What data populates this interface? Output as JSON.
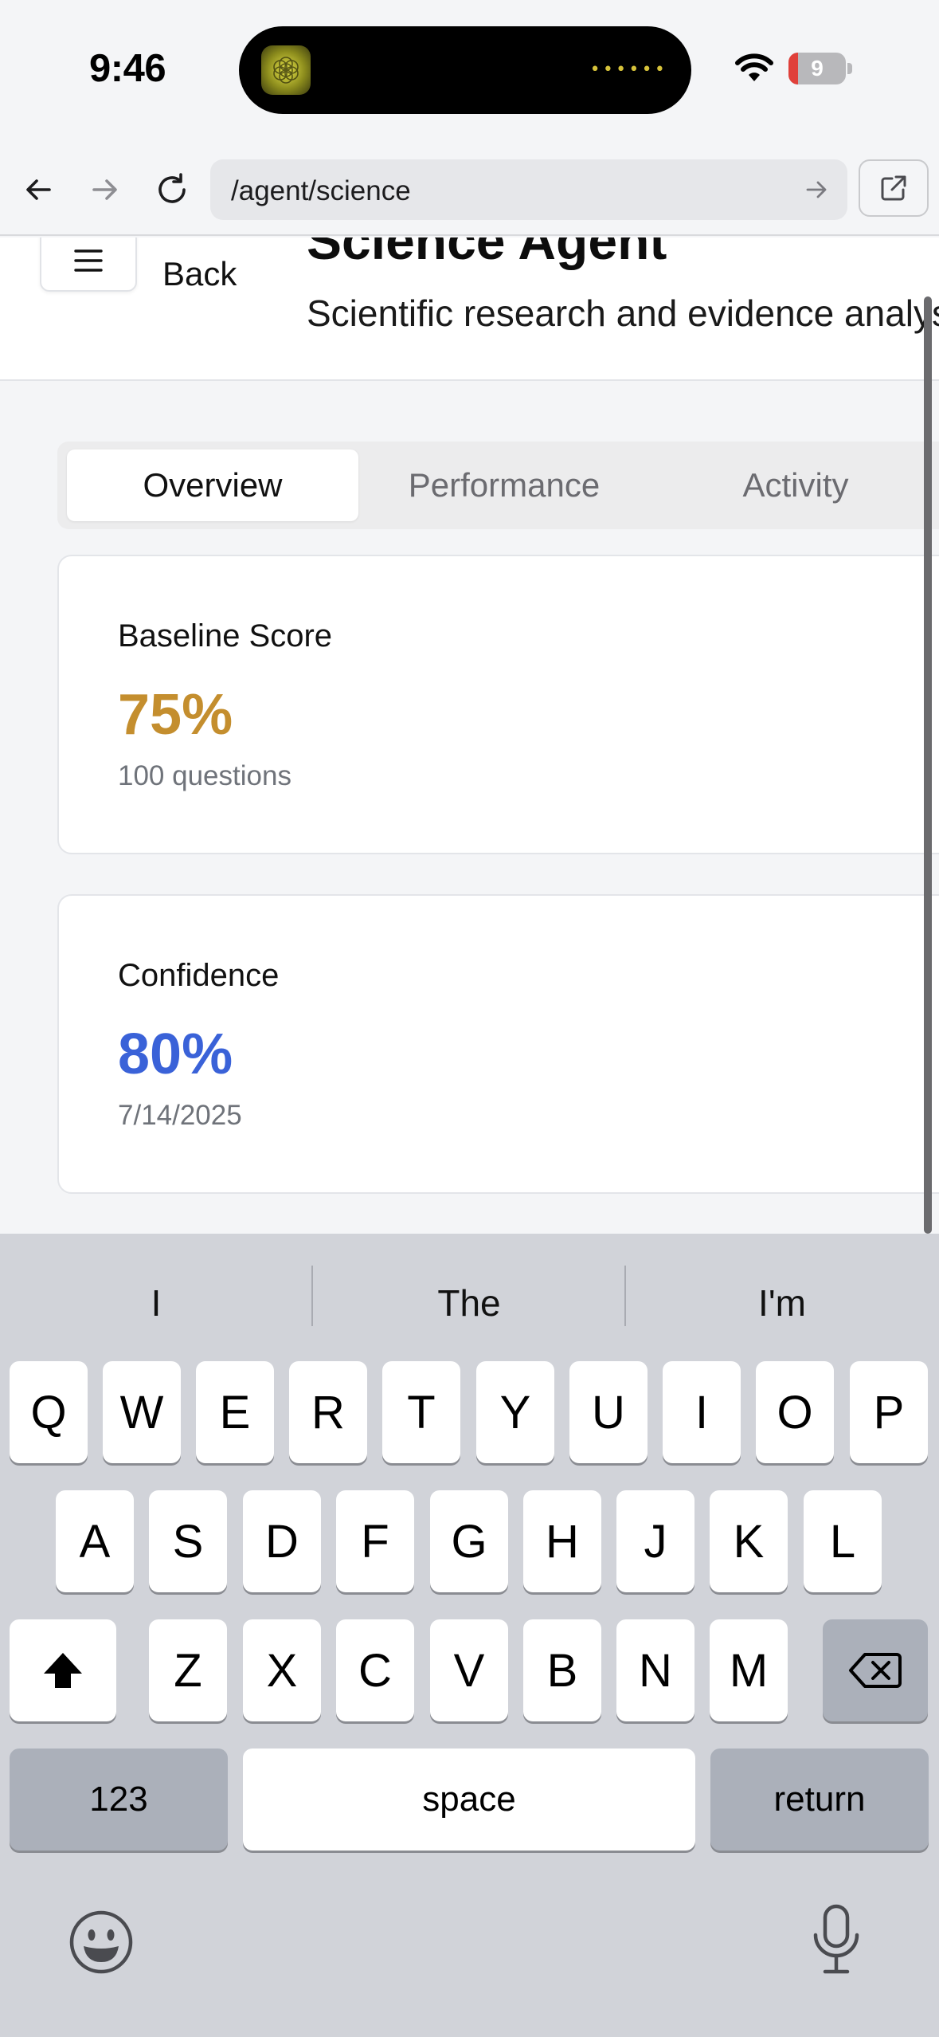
{
  "status_bar": {
    "time": "9:46",
    "battery_level": "9",
    "battery_fill_percent": 9,
    "island_dots": "••••••"
  },
  "browser": {
    "url": "/agent/science"
  },
  "header": {
    "back_label": "Back",
    "title": "Science Agent",
    "subtitle": "Scientific research and evidence analysis"
  },
  "tabs": [
    {
      "label": "Overview",
      "active": true
    },
    {
      "label": "Performance",
      "active": false
    },
    {
      "label": "Activity",
      "active": false
    }
  ],
  "cards": [
    {
      "label": "Baseline Score",
      "value": "75%",
      "sub": "100 questions",
      "value_color": "#c48e2e"
    },
    {
      "label": "Confidence",
      "value": "80%",
      "sub": "7/14/2025",
      "value_color": "#3a62d8"
    }
  ],
  "keyboard": {
    "suggestions": [
      "I",
      "The",
      "I'm"
    ],
    "row1": [
      "Q",
      "W",
      "E",
      "R",
      "T",
      "Y",
      "U",
      "I",
      "O",
      "P"
    ],
    "row2": [
      "A",
      "S",
      "D",
      "F",
      "G",
      "H",
      "J",
      "K",
      "L"
    ],
    "row3": [
      "Z",
      "X",
      "C",
      "V",
      "B",
      "N",
      "M"
    ],
    "numbers_label": "123",
    "space_label": "space",
    "return_label": "return"
  }
}
